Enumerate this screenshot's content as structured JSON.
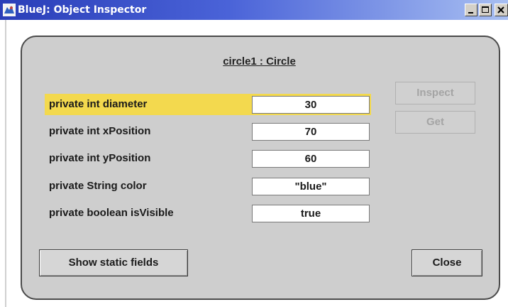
{
  "window": {
    "title": "BlueJ:  Object Inspector",
    "controls": {
      "minimize_icon": "minimize-icon",
      "maximize_icon": "maximize-icon",
      "close_icon": "close-icon"
    }
  },
  "inspector": {
    "object_title": "circle1 : Circle",
    "fields": [
      {
        "label": "private int diameter",
        "value": "30",
        "selected": true
      },
      {
        "label": "private int xPosition",
        "value": "70",
        "selected": false
      },
      {
        "label": "private int yPosition",
        "value": "60",
        "selected": false
      },
      {
        "label": "private String color",
        "value": "\"blue\"",
        "selected": false
      },
      {
        "label": "private boolean isVisible",
        "value": "true",
        "selected": false
      }
    ],
    "inspect_label": "Inspect",
    "get_label": "Get",
    "show_static_label": "Show static fields",
    "close_label": "Close"
  },
  "colors": {
    "selection": "#f3d94e",
    "panel": "#cecece",
    "title_bar": "#2a3eb8"
  }
}
